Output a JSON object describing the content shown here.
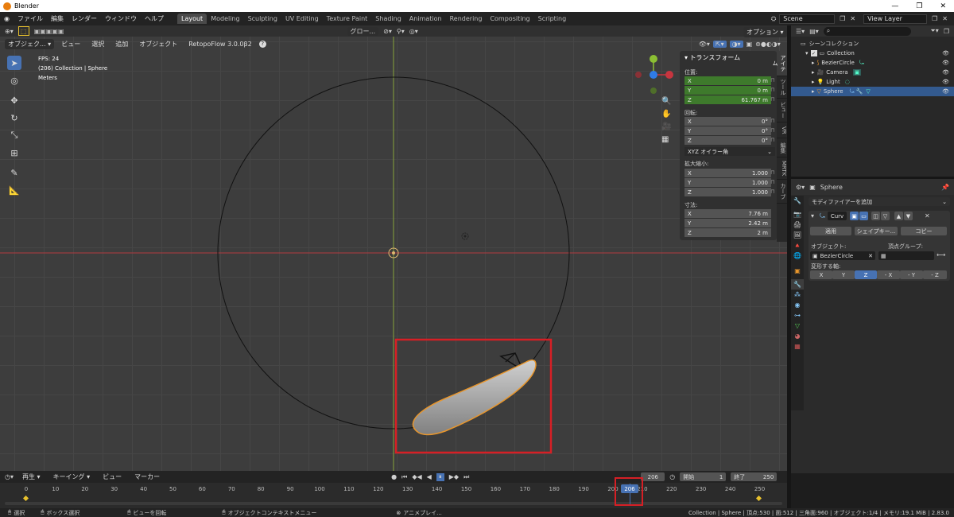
{
  "window": {
    "title": "Blender"
  },
  "menu": {
    "items": [
      "ファイル",
      "編集",
      "レンダー",
      "ウィンドウ",
      "ヘルプ"
    ]
  },
  "workspaces": [
    "Layout",
    "Modeling",
    "Sculpting",
    "UV Editing",
    "Texture Paint",
    "Shading",
    "Animation",
    "Rendering",
    "Compositing",
    "Scripting"
  ],
  "scene": {
    "name": "Scene",
    "view_layer": "View Layer"
  },
  "viewport_header": {
    "mode": "オブジェク...",
    "view": "ビュー",
    "select": "選択",
    "add": "追加",
    "object": "オブジェクト",
    "addon": "RetopoFlow 3.0.0β2",
    "orientation": "グロー...",
    "options": "オプション"
  },
  "overlay_text": {
    "fps": "FPS: 24",
    "collection": "(206) Collection | Sphere",
    "units": "Meters"
  },
  "npanel": {
    "title": "トランスフォーム",
    "location_label": "位置:",
    "location": [
      {
        "axis": "X",
        "value": "0 m"
      },
      {
        "axis": "Y",
        "value": "0 m"
      },
      {
        "axis": "Z",
        "value": "61.767 m"
      }
    ],
    "rotation_label": "回転:",
    "rotation": [
      {
        "axis": "X",
        "value": "0°"
      },
      {
        "axis": "Y",
        "value": "0°"
      },
      {
        "axis": "Z",
        "value": "0°"
      }
    ],
    "rotation_mode": "XYZ オイラー角",
    "scale_label": "拡大縮小:",
    "scale": [
      {
        "axis": "X",
        "value": "1.000"
      },
      {
        "axis": "Y",
        "value": "1.000"
      },
      {
        "axis": "Z",
        "value": "1.000"
      }
    ],
    "dimensions_label": "寸法:",
    "dimensions": [
      {
        "axis": "X",
        "value": "7.76 m"
      },
      {
        "axis": "Y",
        "value": "2.42 m"
      },
      {
        "axis": "Z",
        "value": "2 m"
      }
    ]
  },
  "side_tabs": [
    "アイテム",
    "ツール",
    "ビュー",
    "VR",
    "編集",
    "MRTK",
    "カーブ"
  ],
  "outliner": {
    "root": "シーンコレクション",
    "collection": "Collection",
    "items": [
      {
        "name": "BezierCircle"
      },
      {
        "name": "Camera"
      },
      {
        "name": "Light"
      },
      {
        "name": "Sphere"
      }
    ]
  },
  "properties": {
    "object_name": "Sphere",
    "add_modifier": "モディファイアーを追加",
    "modifier_name": "Curv",
    "apply": "適用",
    "shape_key": "シェイプキー...",
    "copy": "コピー",
    "object_label": "オブジェクト:",
    "object_value": "BezierCircle",
    "vgroup_label": "頂点グループ:",
    "deform_axis_label": "変形する軸:",
    "axes": [
      "X",
      "Y",
      "Z",
      "- X",
      "- Y",
      "- Z"
    ],
    "active_axis": "Z"
  },
  "timeline": {
    "play": "再生",
    "keying": "キーイング",
    "view": "ビュー",
    "marker": "マーカー",
    "current_frame": "206",
    "start_label": "開始",
    "start": "1",
    "end_label": "終了",
    "end": "250",
    "ticks": [
      "0",
      "10",
      "20",
      "30",
      "40",
      "50",
      "60",
      "70",
      "80",
      "90",
      "100",
      "110",
      "120",
      "130",
      "140",
      "150",
      "160",
      "170",
      "180",
      "190",
      "200",
      "210",
      "220",
      "230",
      "240",
      "250"
    ]
  },
  "status": {
    "select": "選択",
    "box_select": "ボックス選択",
    "rotate_view": "ビューを回転",
    "context_menu": "オブジェクトコンテキストメニュー",
    "anim_player": "アニメプレイ...",
    "stats": "Collection | Sphere | 頂点:530 | 面:512 | 三角面:960 | オブジェクト:1/4 | メモリ:19.1 MiB | 2.83.0"
  },
  "colors": {
    "accent": "#4772b3",
    "highlight_box": "#d61f25",
    "selection_outline": "#e8962c",
    "x_axis": "#c7353f",
    "y_axis": "#8bbf33",
    "z_axis": "#2f7be6"
  }
}
